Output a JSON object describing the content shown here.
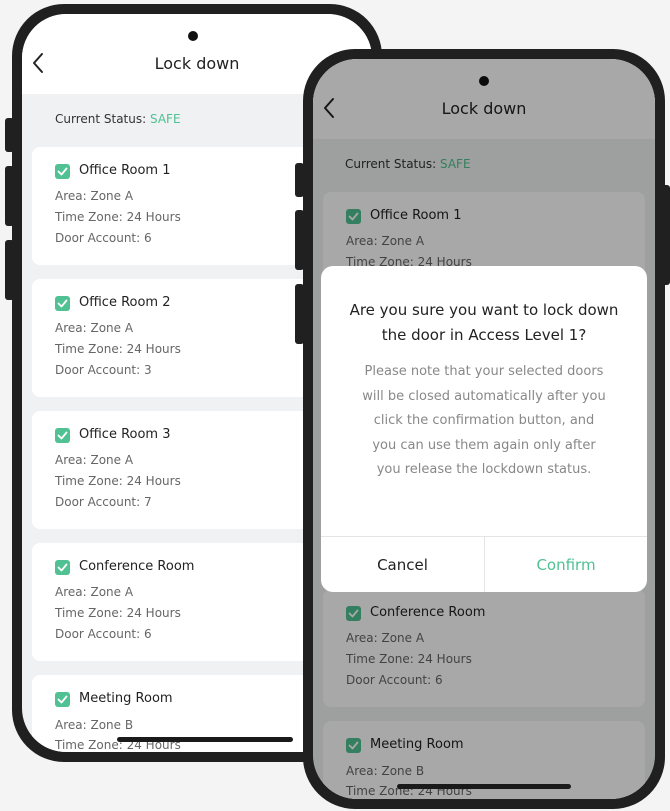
{
  "header": {
    "title": "Lock down"
  },
  "status": {
    "label": "Current Status:",
    "value": "SAFE"
  },
  "rooms": [
    {
      "name": "Office Room 1",
      "area": "Area: Zone A",
      "time_zone": "Time Zone: 24 Hours",
      "door_account": "Door Account: 6"
    },
    {
      "name": "Office Room 2",
      "area": "Area: Zone A",
      "time_zone": "Time Zone: 24 Hours",
      "door_account": "Door Account: 3"
    },
    {
      "name": "Office Room 3",
      "area": "Area: Zone A",
      "time_zone": "Time Zone: 24 Hours",
      "door_account": "Door Account: 7"
    },
    {
      "name": "Conference Room",
      "area": "Area: Zone A",
      "time_zone": "Time Zone: 24 Hours",
      "door_account": "Door Account: 6"
    },
    {
      "name": "Meeting Room",
      "area": "Area: Zone B",
      "time_zone": "Time Zone: 24 Hours",
      "door_account": ""
    }
  ],
  "dialog": {
    "title_line1": "Are you sure you want to lock down",
    "title_line2": "the door in Access Level 1?",
    "body_lines": [
      "Please note that your selected doors",
      "will be closed automatically after you",
      "click the confirmation button, and",
      "you can use them again only after",
      "you release the lockdown status."
    ],
    "cancel_label": "Cancel",
    "confirm_label": "Confirm"
  },
  "colors": {
    "accent": "#4fc192",
    "frame": "#202020",
    "background": "#f0f1f2"
  },
  "icons": {
    "back": "chevron-left-icon",
    "check": "checkbox-checked-icon"
  }
}
